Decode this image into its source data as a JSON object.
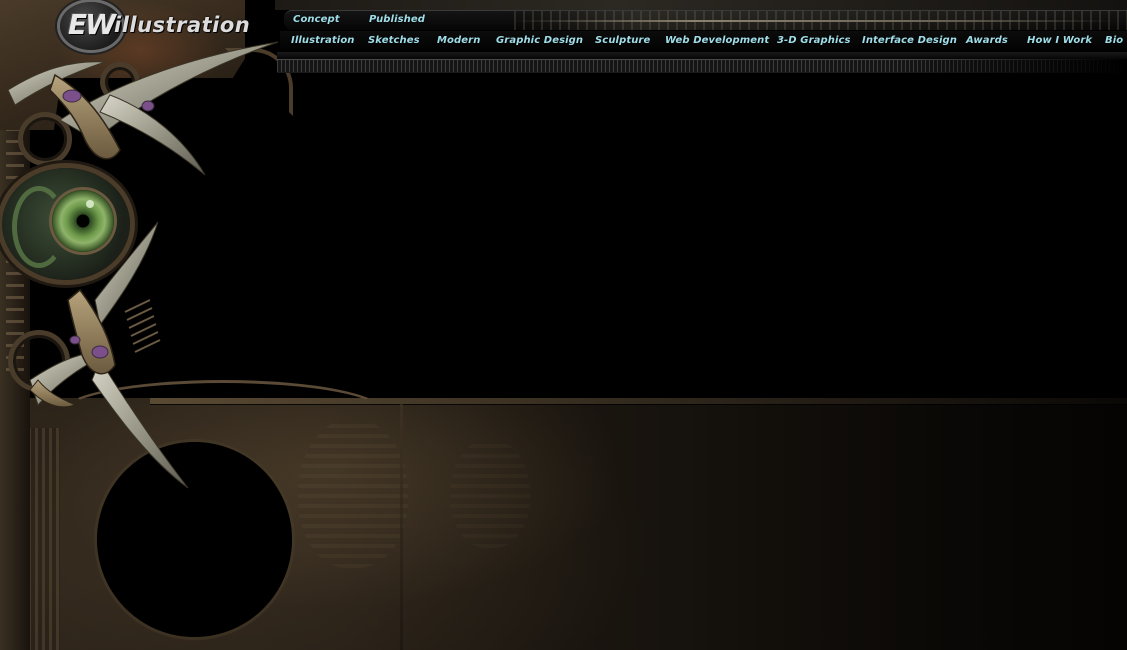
{
  "site": {
    "logo_mark": "EW",
    "logo_word": "illustration"
  },
  "nav_primary": [
    {
      "label": "Concept"
    },
    {
      "label": "Published"
    }
  ],
  "nav_secondary": [
    {
      "label": "Illustration"
    },
    {
      "label": "Sketches"
    },
    {
      "label": "Modern"
    },
    {
      "label": "Graphic Design"
    },
    {
      "label": "Sculpture"
    },
    {
      "label": "Web Development"
    },
    {
      "label": "3-D Graphics"
    },
    {
      "label": "Interface Design"
    },
    {
      "label": "Awards"
    },
    {
      "label": "How I Work"
    },
    {
      "label": "Bio"
    }
  ],
  "colors": {
    "nav_text": "#9fdde8",
    "background": "#000000",
    "bronze": "#3a3022",
    "eye_green": "#6e9a4a"
  }
}
